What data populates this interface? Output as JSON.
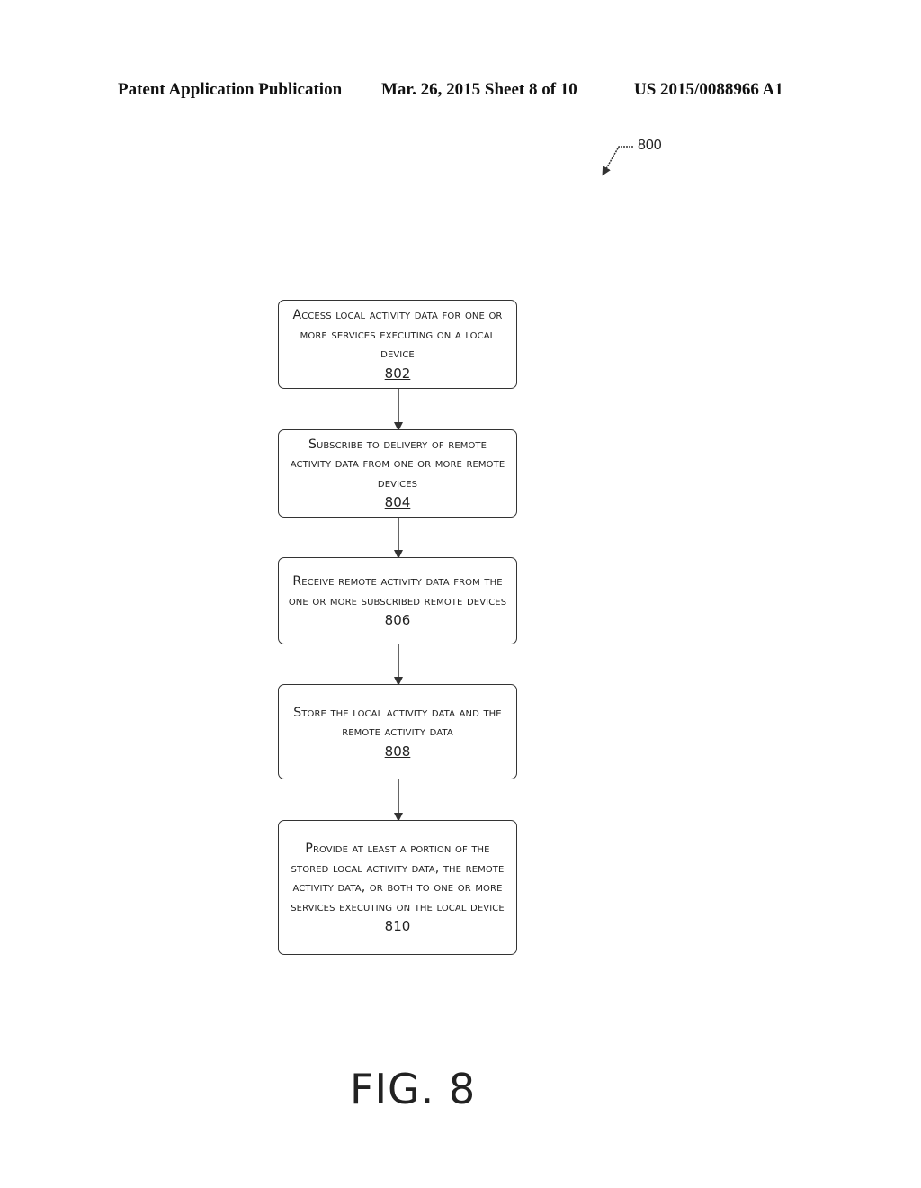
{
  "header": {
    "left": "Patent Application Publication",
    "middle": "Mar. 26, 2015  Sheet 8 of 10",
    "right": "US 2015/0088966 A1"
  },
  "diagram": {
    "reference": "800",
    "figure_label": "FIG. 8",
    "steps": [
      {
        "text": "Access local activity data for one or more services executing on a local device",
        "number": "802"
      },
      {
        "text": "Subscribe to delivery of remote activity data from one or more remote devices",
        "number": "804"
      },
      {
        "text": "Receive remote activity data from the one or more subscribed remote devices",
        "number": "806"
      },
      {
        "text": "Store the local activity data and the remote activity data",
        "number": "808"
      },
      {
        "text": "Provide at least a portion of the stored local activity data, the remote activity data, or both to one or more services executing on the local device",
        "number": "810"
      }
    ]
  }
}
